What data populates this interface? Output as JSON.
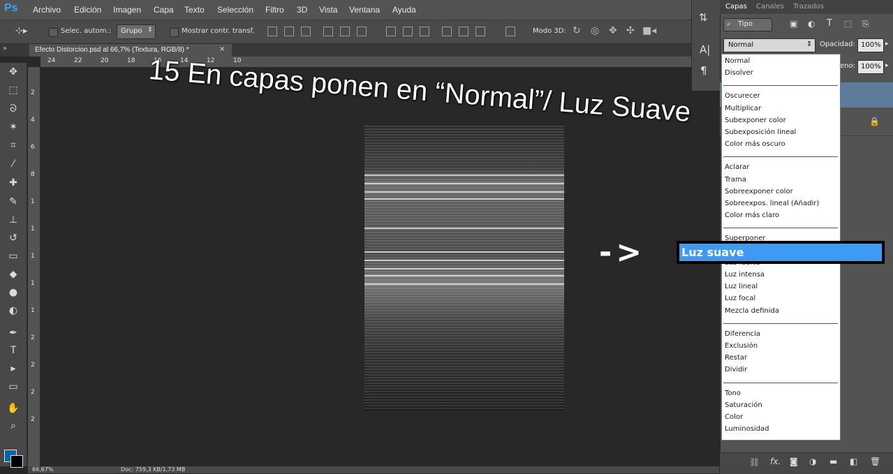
{
  "app": {
    "logo": "Ps"
  },
  "menu": [
    "Archivo",
    "Edición",
    "Imagen",
    "Capa",
    "Texto",
    "Selección",
    "Filtro",
    "3D",
    "Vista",
    "Ventana",
    "Ayuda"
  ],
  "options": {
    "auto_select_label": "Selec. autom.:",
    "group_value": "Grupo",
    "show_transform_label": "Mostrar contr. transf.",
    "mode3d_label": "Modo 3D:"
  },
  "document": {
    "tab_label": "Efecto Distorcion.psd al 66,7% (Textura, RGB/8) *",
    "close": "×"
  },
  "ruler": {
    "h_ticks": [
      "24",
      "22",
      "20",
      "18",
      "16",
      "14",
      "12",
      "10"
    ],
    "v_ticks": [
      "2",
      "4",
      "6",
      "8",
      "1",
      "1",
      "1",
      "1",
      "1",
      "2",
      "2",
      "2",
      "2"
    ]
  },
  "status": {
    "zoom": "66,67%",
    "doc": "Doc: 759,3 KB/1,73 MB"
  },
  "panel": {
    "tabs": [
      "Capas",
      "Canales",
      "Trazados"
    ],
    "kind_filter": "Tipo",
    "blend_mode": "Normal",
    "opacity_label": "Opacidad:",
    "opacity_value": "100%",
    "fill_label": "eno:",
    "fill_value": "100%"
  },
  "blend_groups": [
    [
      "Normal",
      "Disolver"
    ],
    [
      "Oscurecer",
      "Multiplicar",
      "Subexponer color",
      "Subexposición lineal",
      "Color más oscuro"
    ],
    [
      "Aclarar",
      "Trama",
      "Sobreexponer color",
      "Sobreexpos. lineal (Añadir)",
      "Color más claro"
    ],
    [
      "Superponer",
      "Luz suave",
      "Luz fuerte",
      "Luz intensa",
      "Luz lineal",
      "Luz focal",
      "Mezcla definida"
    ],
    [
      "Diferencia",
      "Exclusión",
      "Restar",
      "Dividir"
    ],
    [
      "Tono",
      "Saturación",
      "Color",
      "Luminosidad"
    ]
  ],
  "highlight": {
    "label": "Luz suave"
  },
  "annotation": {
    "text": "15 En capas ponen en “Normal”/ Luz Suave",
    "arrow": "->"
  },
  "colors": {
    "accent": "#3d9bf5",
    "foreground": "#0066aa",
    "background": "#000000"
  }
}
